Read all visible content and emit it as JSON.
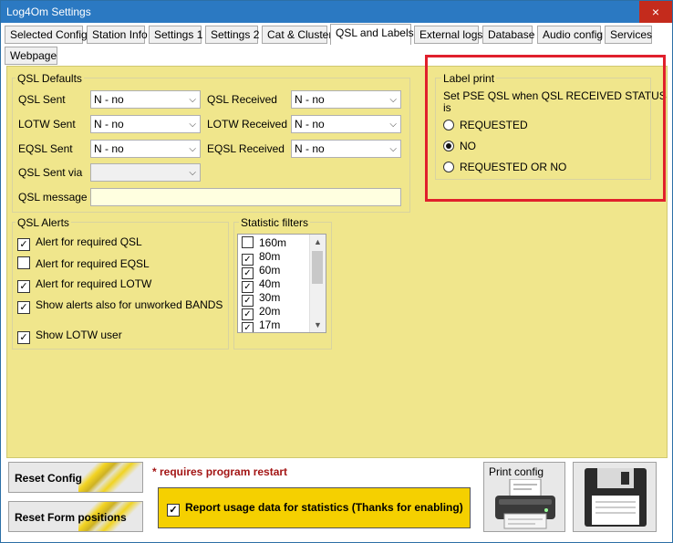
{
  "window": {
    "title": "Log4Om Settings",
    "close_glyph": "×"
  },
  "tabs": [
    {
      "label": "Selected Config"
    },
    {
      "label": "Station Info"
    },
    {
      "label": "Settings 1"
    },
    {
      "label": "Settings 2"
    },
    {
      "label": "Cat & Cluster"
    },
    {
      "label": "QSL and Labels"
    },
    {
      "label": "External logs"
    },
    {
      "label": "Database"
    },
    {
      "label": "Audio config"
    },
    {
      "label": "Services"
    },
    {
      "label": "Webpage"
    }
  ],
  "active_tab": "QSL and Labels",
  "qsl_defaults": {
    "title": "QSL Defaults",
    "qsl_sent": {
      "label": "QSL Sent",
      "value": "N - no"
    },
    "qsl_received": {
      "label": "QSL Received",
      "value": "N - no"
    },
    "lotw_sent": {
      "label": "LOTW Sent",
      "value": "N - no"
    },
    "lotw_received": {
      "label": "LOTW Received",
      "value": "N - no"
    },
    "eqsl_sent": {
      "label": "EQSL Sent",
      "value": "N - no"
    },
    "eqsl_received": {
      "label": "EQSL Received",
      "value": "N - no"
    },
    "qsl_sent_via": {
      "label": "QSL Sent via",
      "value": ""
    },
    "qsl_message": {
      "label": "QSL message",
      "value": ""
    }
  },
  "qsl_alerts": {
    "title": "QSL Alerts",
    "items": [
      {
        "label": "Alert for required QSL",
        "checked": true
      },
      {
        "label": "Alert for required EQSL",
        "checked": false
      },
      {
        "label": "Alert for required LOTW",
        "checked": true
      },
      {
        "label": "Show alerts also for unworked BANDS",
        "checked": true
      },
      {
        "label": "Show LOTW user",
        "checked": true
      }
    ]
  },
  "statistic_filters": {
    "title": "Statistic filters",
    "items": [
      {
        "label": "160m",
        "checked": false
      },
      {
        "label": "80m",
        "checked": true
      },
      {
        "label": "60m",
        "checked": true
      },
      {
        "label": "40m",
        "checked": true
      },
      {
        "label": "30m",
        "checked": true
      },
      {
        "label": "20m",
        "checked": true
      },
      {
        "label": "17m",
        "checked": true
      }
    ]
  },
  "label_print": {
    "title": "Label print",
    "description_line1": "Set PSE QSL when QSL RECEIVED STATUS",
    "description_line2": "is",
    "options": [
      {
        "label": "REQUESTED",
        "selected": false
      },
      {
        "label": "NO",
        "selected": true
      },
      {
        "label": "REQUESTED OR NO",
        "selected": false
      }
    ]
  },
  "footer": {
    "reset_config": "Reset Config",
    "reset_form_positions": "Reset Form positions",
    "restart_note": "* requires program restart",
    "usage_report": {
      "label": "Report usage data for statistics (Thanks for enabling)",
      "checked": true
    },
    "print_config": "Print config"
  },
  "colors": {
    "panel_bg": "#f0e68c",
    "title_bar": "#2b79c2",
    "highlight_box": "#e0202c",
    "usage_bg": "#f5d000",
    "restart_text": "#a31515"
  },
  "icons": {
    "print": "printer-icon",
    "save": "floppy-disk-icon",
    "dropdown": "chevron-down-icon"
  }
}
